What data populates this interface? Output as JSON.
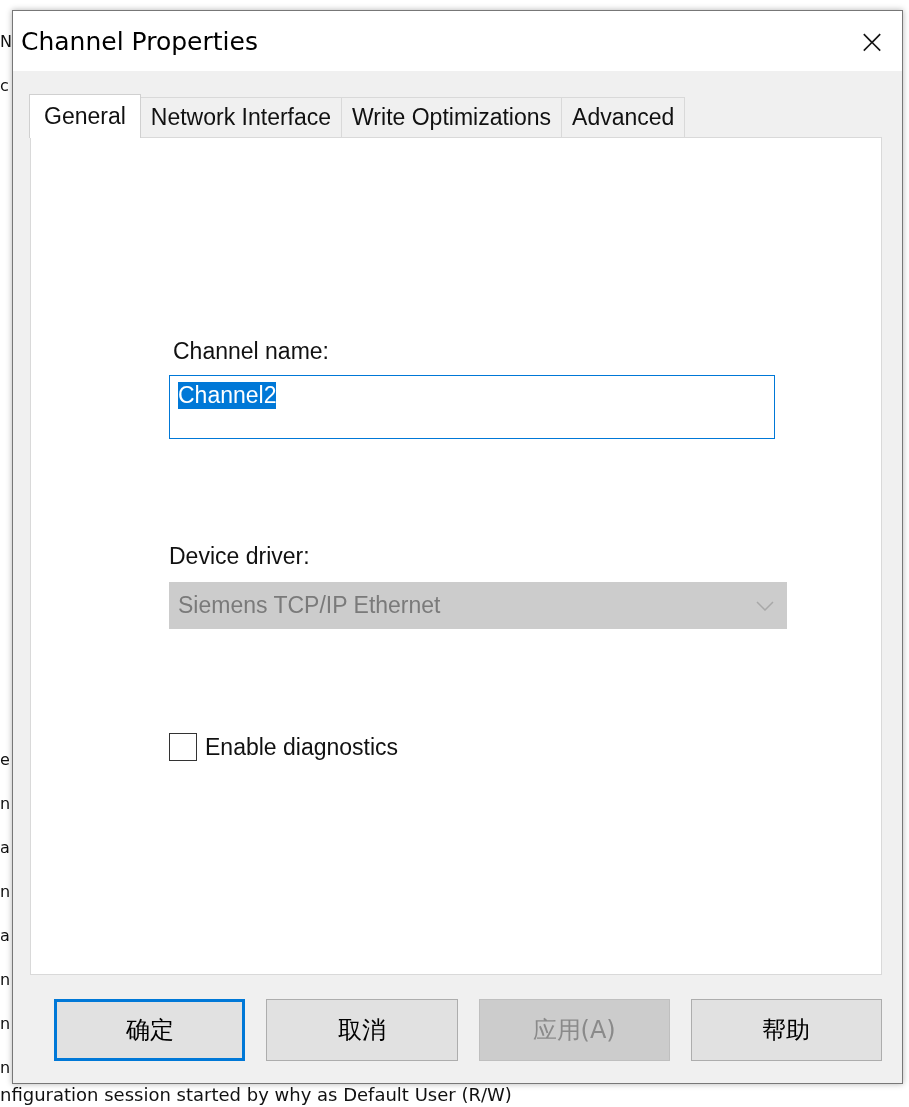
{
  "background": {
    "fragments": [
      "N",
      "c",
      "e",
      "n",
      "a",
      "n",
      "a",
      "n",
      "n",
      "n"
    ],
    "status_line": "nfiguration session started by why as Default User (R/W)"
  },
  "window": {
    "title": "Channel Properties",
    "close": "×"
  },
  "tabs": [
    {
      "label": "General",
      "selected": true
    },
    {
      "label": "Network Interface",
      "selected": false
    },
    {
      "label": "Write Optimizations",
      "selected": false
    },
    {
      "label": "Advanced",
      "selected": false
    }
  ],
  "channel_name": {
    "label": "Channel name:",
    "value": "Channel2",
    "selected_text": true
  },
  "device_driver": {
    "label": "Device driver:",
    "value": "Siemens TCP/IP Ethernet",
    "disabled": true
  },
  "diagnostics": {
    "label": "Enable diagnostics",
    "checked": false
  },
  "buttons": [
    {
      "label": "确定",
      "default": true,
      "disabled": false
    },
    {
      "label": "取消",
      "default": false,
      "disabled": false
    },
    {
      "label": "应用(A)",
      "default": false,
      "disabled": true
    },
    {
      "label": "帮助",
      "default": false,
      "disabled": false
    }
  ]
}
